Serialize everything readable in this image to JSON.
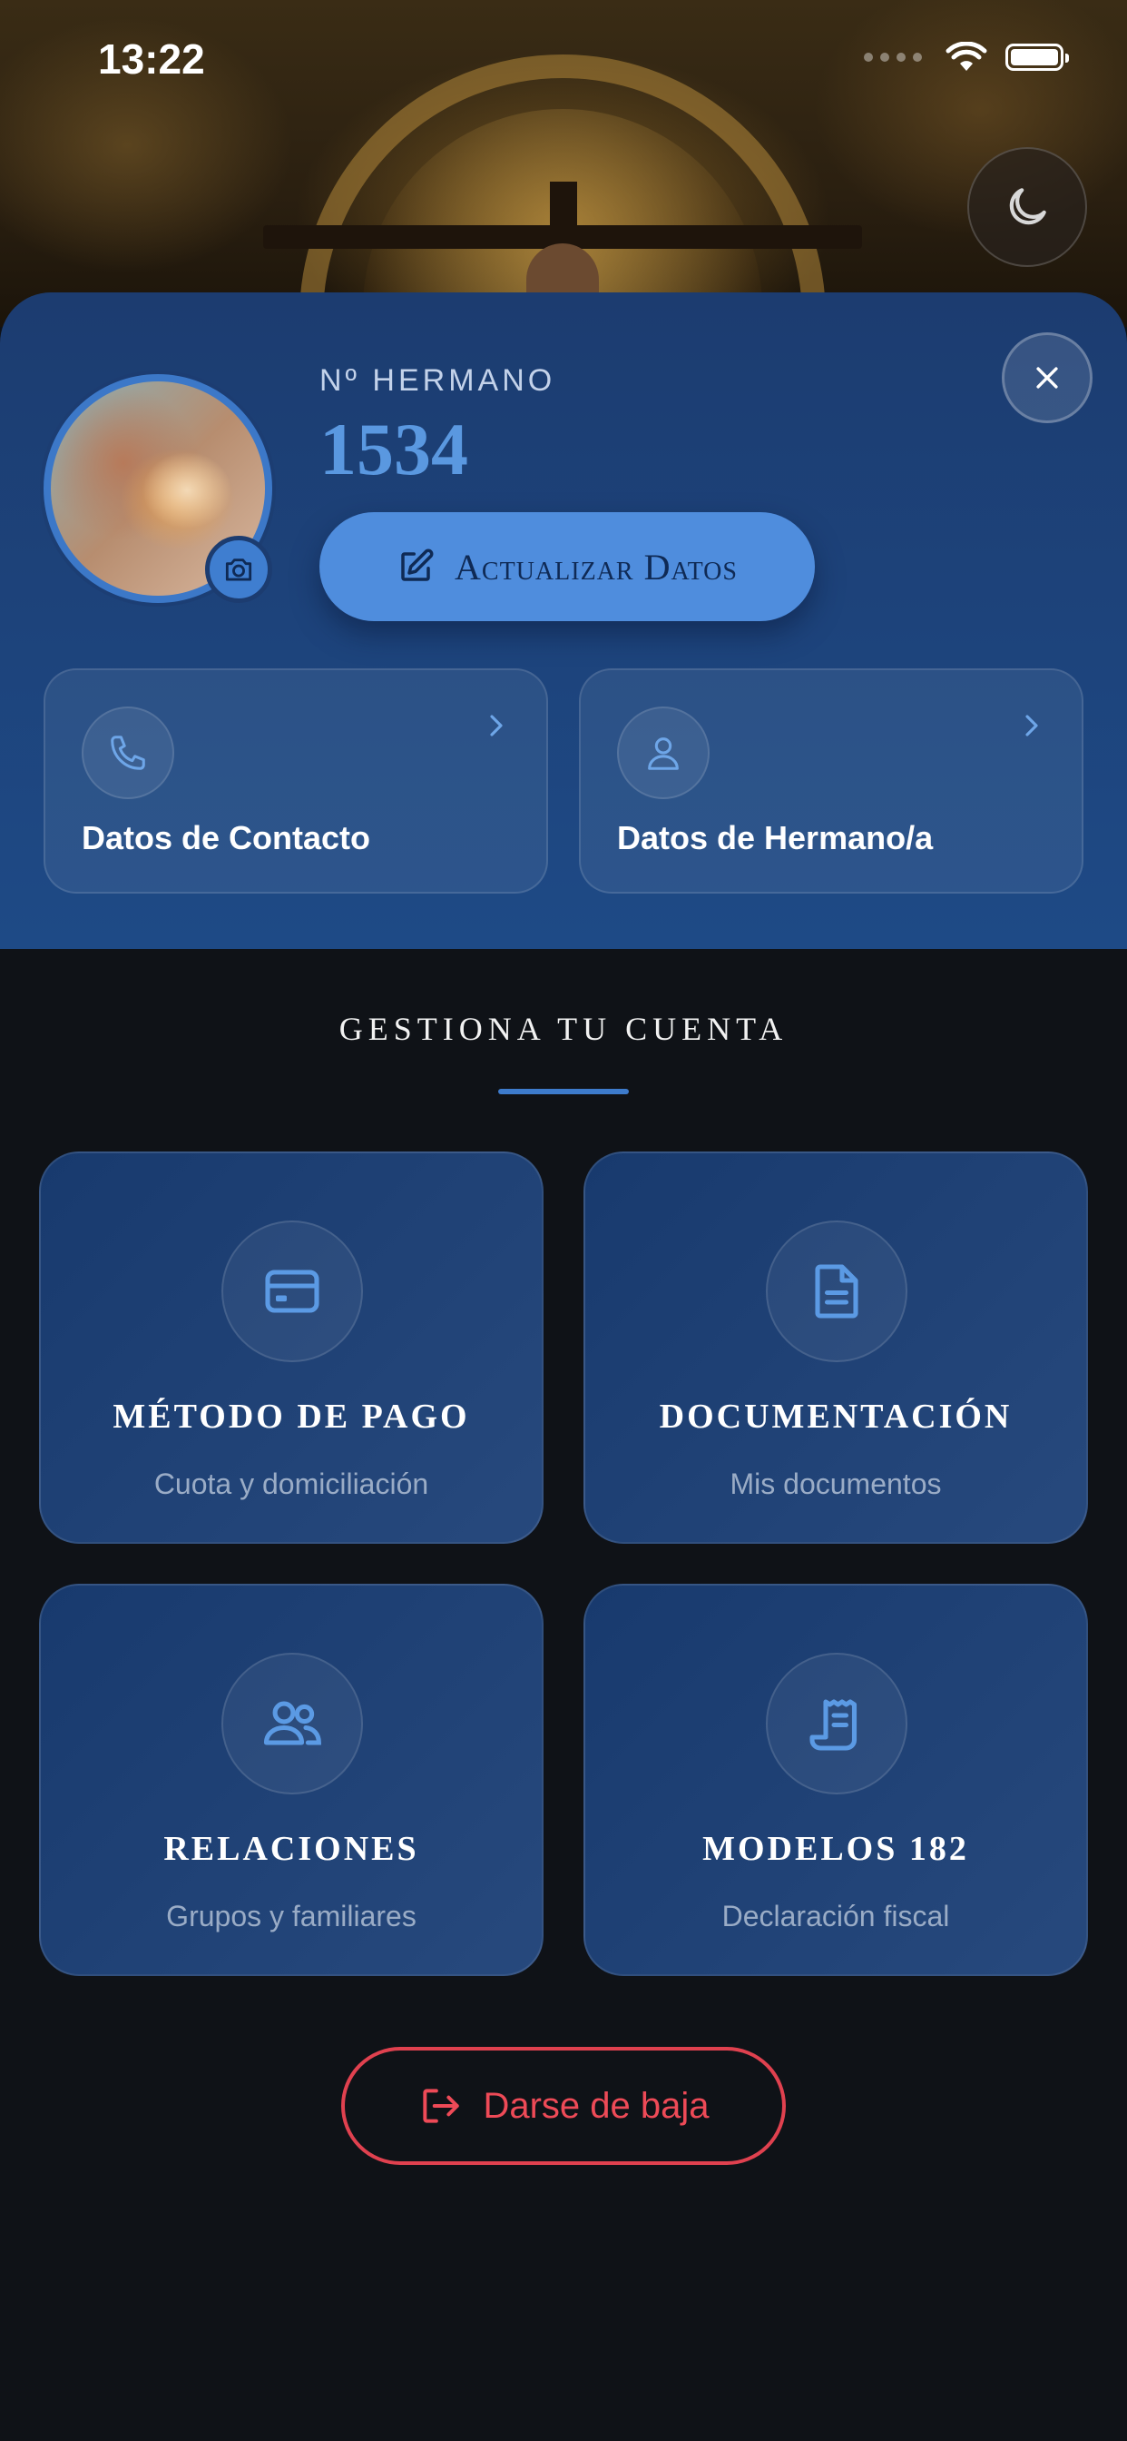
{
  "status_bar": {
    "time": "13:22"
  },
  "profile": {
    "member_label": "Nº HERMANO",
    "member_number": "1534",
    "update_button": "Actualizar Datos"
  },
  "info_cards": [
    {
      "label": "Datos de Contacto",
      "icon": "phone-icon"
    },
    {
      "label": "Datos de Hermano/a",
      "icon": "person-icon"
    }
  ],
  "section": {
    "title": "GESTIONA TU CUENTA"
  },
  "tiles": [
    {
      "title": "MÉTODO DE PAGO",
      "subtitle": "Cuota y domiciliación",
      "icon": "credit-card-icon"
    },
    {
      "title": "DOCUMENTACIÓN",
      "subtitle": "Mis documentos",
      "icon": "document-icon"
    },
    {
      "title": "RELACIONES",
      "subtitle": "Grupos y familiares",
      "icon": "users-icon"
    },
    {
      "title": "MODELOS 182",
      "subtitle": "Declaración fiscal",
      "icon": "receipt-icon"
    }
  ],
  "leave_button": "Darse de baja",
  "colors": {
    "accent": "#4f8ddd",
    "sheet": "#1e4a86",
    "danger": "#e0414f",
    "background": "#0f1217"
  }
}
